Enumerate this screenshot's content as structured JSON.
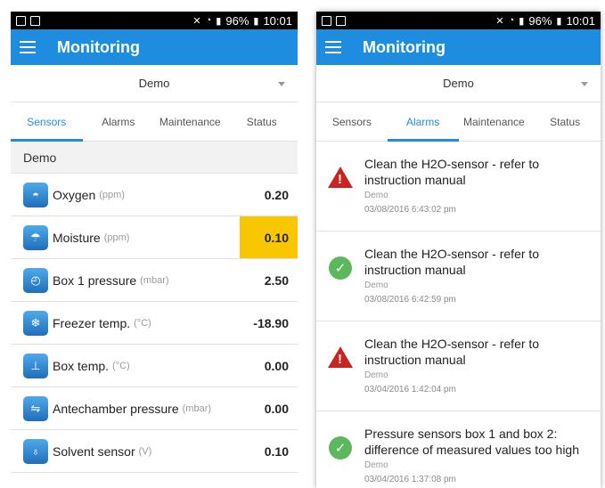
{
  "statusbar": {
    "battery": "96%",
    "time": "10:01"
  },
  "app": {
    "title": "Monitoring",
    "selected_site": "Demo"
  },
  "tabs": [
    "Sensors",
    "Alarms",
    "Maintenance",
    "Status"
  ],
  "sensors_screen": {
    "active_tab": "Sensors",
    "group": "Demo",
    "rows": [
      {
        "name": "Oxygen",
        "unit": "(ppm)",
        "value": "0.20",
        "icon": "oxygen-icon",
        "alert": false
      },
      {
        "name": "Moisture",
        "unit": "(ppm)",
        "value": "0.10",
        "icon": "moisture-icon",
        "alert": true
      },
      {
        "name": "Box 1 pressure",
        "unit": "(mbar)",
        "value": "2.50",
        "icon": "pressure-gauge-icon",
        "alert": false
      },
      {
        "name": "Freezer temp.",
        "unit": "(°C)",
        "value": "-18.90",
        "icon": "freezer-icon",
        "alert": false
      },
      {
        "name": "Box temp.",
        "unit": "(°C)",
        "value": "0.00",
        "icon": "thermometer-icon",
        "alert": false
      },
      {
        "name": "Antechamber pressure",
        "unit": "(mbar)",
        "value": "0.00",
        "icon": "antechamber-icon",
        "alert": false
      },
      {
        "name": "Solvent sensor",
        "unit": "(V)",
        "value": "0.10",
        "icon": "solvent-bottle-icon",
        "alert": false
      }
    ]
  },
  "alarms_screen": {
    "active_tab": "Alarms",
    "items": [
      {
        "title": "Clean the H2O-sensor - refer to instruction manual",
        "source": "Demo",
        "date": "03/08/2016 6:43:02 pm",
        "state": "warning"
      },
      {
        "title": "Clean the H2O-sensor - refer to instruction manual",
        "source": "Demo",
        "date": "03/08/2016 6:42:59 pm",
        "state": "resolved"
      },
      {
        "title": "Clean the H2O-sensor - refer to instruction manual",
        "source": "Demo",
        "date": "03/04/2016 1:42:04 pm",
        "state": "warning"
      },
      {
        "title": "Pressure sensors box 1 and box 2: difference of measured values too high",
        "source": "Demo",
        "date": "03/04/2016 1:37:08 pm",
        "state": "resolved"
      }
    ]
  },
  "colors": {
    "primary": "#1e8ddf",
    "alert_highlight": "#f9c700",
    "warning_red": "#cc2222",
    "ok_green": "#5cb85c"
  }
}
